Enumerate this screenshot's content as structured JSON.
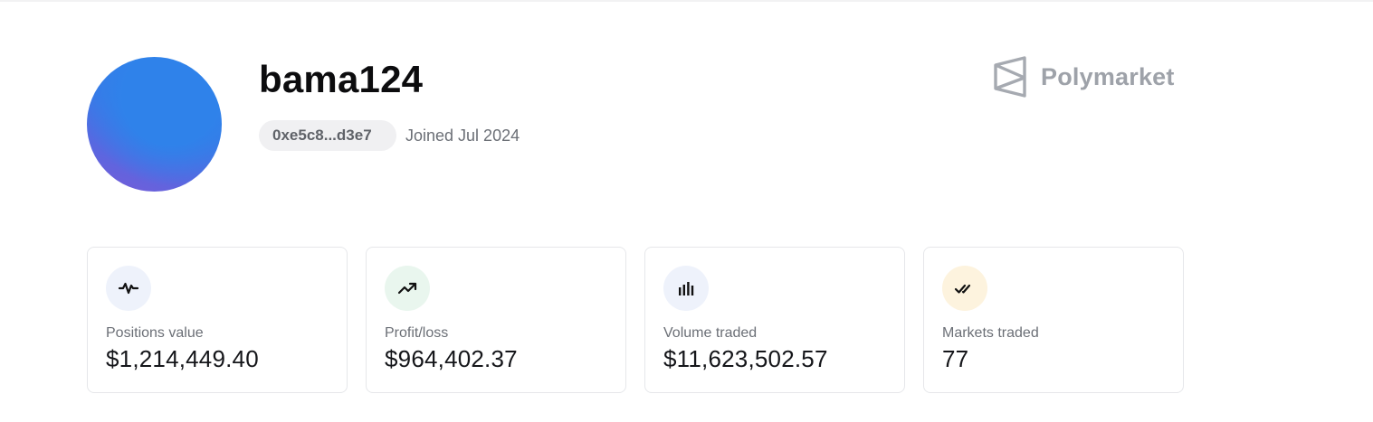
{
  "profile": {
    "username": "bama124",
    "address": "0xe5c8...d3e7",
    "joined": "Joined Jul 2024"
  },
  "brand": {
    "name": "Polymarket",
    "logo_icon": "polymarket-logo-icon"
  },
  "stats": [
    {
      "label": "Positions value",
      "value": "$1,214,449.40",
      "icon": "activity-icon",
      "icon_bg": "#eef2fb"
    },
    {
      "label": "Profit/loss",
      "value": "$964,402.37",
      "icon": "trending-up-icon",
      "icon_bg": "#e9f6ee"
    },
    {
      "label": "Volume traded",
      "value": "$11,623,502.57",
      "icon": "bar-chart-icon",
      "icon_bg": "#eef2fb"
    },
    {
      "label": "Markets traded",
      "value": "77",
      "icon": "double-check-icon",
      "icon_bg": "#fdf3de"
    }
  ],
  "colors": {
    "avatar_primary": "#2f82ea",
    "avatar_secondary": "#7a5ad6",
    "brand_gray": "#9ea2a9"
  }
}
